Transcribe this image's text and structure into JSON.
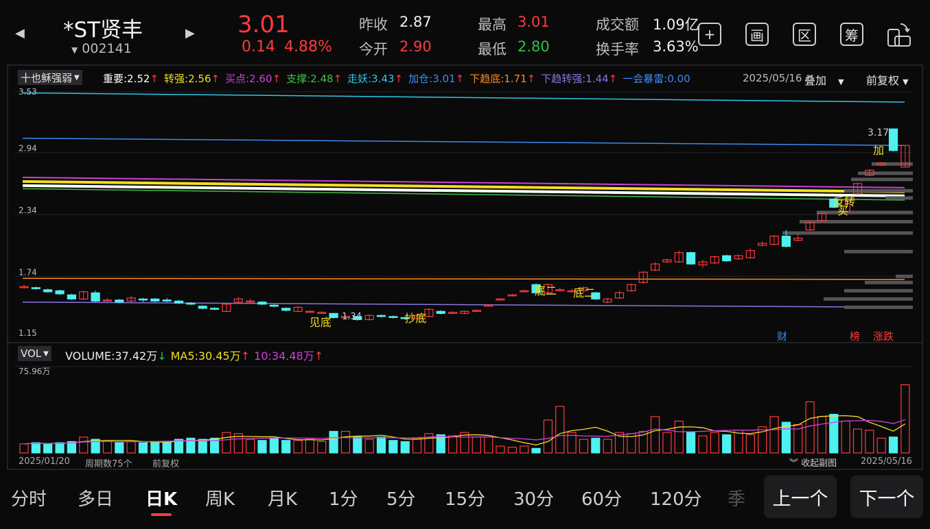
{
  "stock": {
    "name": "*ST贤丰",
    "code": "002141",
    "price": "3.01",
    "change": "0.14",
    "change_pct": "4.88%",
    "prev_close_label": "昨收",
    "prev_close": "2.87",
    "open_label": "今开",
    "open": "2.90",
    "high_label": "最高",
    "high": "3.01",
    "low_label": "最低",
    "low": "2.80",
    "amount_label": "成交额",
    "amount": "1.09亿",
    "turnover_label": "换手率",
    "turnover": "3.63%"
  },
  "toolbar": {
    "add": "+",
    "draw": "画",
    "zone": "区",
    "chip": "筹"
  },
  "indicator": {
    "selector": "十也稣强弱",
    "items": [
      {
        "label": "重要:2.52",
        "arrow": "↑",
        "color": "#ffffff"
      },
      {
        "label": "转强:2.56",
        "arrow": "↑",
        "color": "#f0e020"
      },
      {
        "label": "买点:2.60",
        "arrow": "↑",
        "color": "#d040d8"
      },
      {
        "label": "支撑:2.48",
        "arrow": "↑",
        "color": "#40c040"
      },
      {
        "label": "走妖:3.43",
        "arrow": "↑",
        "color": "#30c8e8"
      },
      {
        "label": "加仓:3.01",
        "arrow": "↑",
        "color": "#3c8cf0"
      },
      {
        "label": "下趋底:1.71",
        "arrow": "↑",
        "color": "#ff8c1a"
      },
      {
        "label": "下趋转强:1.44",
        "arrow": "↑",
        "color": "#8878e0"
      },
      {
        "label": "一会暴雷:0.00",
        "arrow": "",
        "color": "#3c8cf0"
      }
    ],
    "date": "2025/05/16",
    "overlay": "叠加",
    "adjust": "前复权"
  },
  "price_axis": [
    "3.53",
    "2.94",
    "2.34",
    "1.74",
    "1.15"
  ],
  "annotations": {
    "jiandi": "见底",
    "low_val": "1.34",
    "chaodi": "抄底",
    "dier1": "底二",
    "dier2": "底二",
    "fanzhuan": "反转",
    "mai": "买",
    "jia": "加",
    "high_val": "3.17",
    "cai": "财",
    "bang": "榜",
    "zhangdie": "涨跌"
  },
  "volume": {
    "selector": "VOL",
    "label": "VOLUME:37.42万",
    "label_arrow": "↓",
    "ma5": "MA5:30.45万",
    "ma5_arrow": "↑",
    "ma10": "10:34.48万",
    "ma10_arrow": "↑",
    "axis_max": "75.96万"
  },
  "footer": {
    "start_date": "2025/01/20",
    "period_count": "周期数75个",
    "adjust": "前复权",
    "collapse": "收起副图",
    "end_date": "2025/05/16"
  },
  "tabs": [
    "分时",
    "多日",
    "日K",
    "周K",
    "月K",
    "1分",
    "5分",
    "15分",
    "30分",
    "60分",
    "120分",
    "季"
  ],
  "active_tab": 2,
  "nav": {
    "prev": "上一个",
    "next": "下一个"
  },
  "colors": {
    "up": "#ff3b3b",
    "down": "#4ef0f0",
    "bg": "#0a0a0b"
  },
  "chart_data": {
    "type": "candlestick",
    "price_range": [
      1.15,
      3.53
    ],
    "volume_max_wan": 75.96,
    "candles": [
      [
        1.63,
        1.64,
        1.66,
        1.62
      ],
      [
        1.63,
        1.62,
        1.64,
        1.61
      ],
      [
        1.61,
        1.59,
        1.62,
        1.58
      ],
      [
        1.6,
        1.57,
        1.61,
        1.56
      ],
      [
        1.56,
        1.52,
        1.57,
        1.51
      ],
      [
        1.52,
        1.59,
        1.6,
        1.51
      ],
      [
        1.58,
        1.5,
        1.6,
        1.49
      ],
      [
        1.51,
        1.51,
        1.53,
        1.5
      ],
      [
        1.51,
        1.49,
        1.52,
        1.48
      ],
      [
        1.5,
        1.53,
        1.55,
        1.49
      ],
      [
        1.52,
        1.51,
        1.53,
        1.49
      ],
      [
        1.52,
        1.5,
        1.53,
        1.49
      ],
      [
        1.51,
        1.5,
        1.53,
        1.49
      ],
      [
        1.5,
        1.48,
        1.51,
        1.47
      ],
      [
        1.48,
        1.47,
        1.49,
        1.46
      ],
      [
        1.45,
        1.43,
        1.46,
        1.42
      ],
      [
        1.43,
        1.42,
        1.44,
        1.41
      ],
      [
        1.4,
        1.47,
        1.48,
        1.39
      ],
      [
        1.49,
        1.52,
        1.54,
        1.48
      ],
      [
        1.5,
        1.5,
        1.52,
        1.48
      ],
      [
        1.49,
        1.47,
        1.5,
        1.46
      ],
      [
        1.46,
        1.45,
        1.47,
        1.44
      ],
      [
        1.43,
        1.41,
        1.44,
        1.4
      ],
      [
        1.4,
        1.44,
        1.45,
        1.39
      ],
      [
        1.4,
        1.4,
        1.41,
        1.39
      ],
      [
        1.39,
        1.39,
        1.4,
        1.38
      ],
      [
        1.38,
        1.34,
        1.38,
        1.33
      ],
      [
        1.35,
        1.35,
        1.36,
        1.34
      ],
      [
        1.35,
        1.32,
        1.36,
        1.31
      ],
      [
        1.32,
        1.36,
        1.37,
        1.31
      ],
      [
        1.36,
        1.35,
        1.37,
        1.34
      ],
      [
        1.35,
        1.34,
        1.36,
        1.33
      ],
      [
        1.34,
        1.33,
        1.35,
        1.32
      ],
      [
        1.33,
        1.36,
        1.37,
        1.32
      ],
      [
        1.35,
        1.42,
        1.43,
        1.34
      ],
      [
        1.4,
        1.38,
        1.41,
        1.37
      ],
      [
        1.39,
        1.39,
        1.4,
        1.38
      ],
      [
        1.38,
        1.4,
        1.41,
        1.37
      ],
      [
        1.4,
        1.41,
        1.42,
        1.39
      ],
      [
        1.46,
        1.46,
        1.47,
        1.45
      ],
      [
        1.52,
        1.52,
        1.53,
        1.51
      ],
      [
        1.56,
        1.56,
        1.57,
        1.55
      ],
      [
        1.6,
        1.6,
        1.61,
        1.59
      ],
      [
        1.66,
        1.58,
        1.67,
        1.57
      ],
      [
        1.58,
        1.66,
        1.67,
        1.57
      ],
      [
        1.61,
        1.61,
        1.63,
        1.59
      ],
      [
        1.59,
        1.6,
        1.62,
        1.58
      ],
      [
        1.6,
        1.63,
        1.64,
        1.58
      ],
      [
        1.58,
        1.52,
        1.59,
        1.51
      ],
      [
        1.49,
        1.52,
        1.53,
        1.48
      ],
      [
        1.53,
        1.58,
        1.6,
        1.52
      ],
      [
        1.6,
        1.66,
        1.67,
        1.59
      ],
      [
        1.68,
        1.78,
        1.79,
        1.67
      ],
      [
        1.8,
        1.86,
        1.88,
        1.79
      ],
      [
        1.88,
        1.9,
        1.91,
        1.87
      ],
      [
        1.88,
        1.97,
        1.99,
        1.87
      ],
      [
        1.97,
        1.86,
        1.98,
        1.85
      ],
      [
        1.85,
        1.88,
        1.9,
        1.82
      ],
      [
        1.87,
        1.93,
        1.94,
        1.86
      ],
      [
        1.94,
        1.89,
        1.95,
        1.88
      ],
      [
        1.91,
        1.94,
        1.95,
        1.9
      ],
      [
        1.92,
        1.99,
        2.01,
        1.91
      ],
      [
        2.04,
        2.06,
        2.08,
        2.03
      ],
      [
        2.05,
        2.13,
        2.14,
        2.04
      ],
      [
        2.13,
        2.03,
        2.19,
        2.02
      ],
      [
        2.09,
        2.11,
        2.15,
        2.08
      ],
      [
        2.19,
        2.26,
        2.27,
        2.18
      ],
      [
        2.28,
        2.35,
        2.36,
        2.27
      ],
      [
        2.49,
        2.41,
        2.5,
        2.4
      ],
      [
        2.37,
        2.48,
        2.49,
        2.36
      ],
      [
        2.54,
        2.64,
        2.65,
        2.53
      ],
      [
        2.72,
        2.77,
        2.78,
        2.71
      ],
      [
        2.82,
        2.84,
        2.85,
        2.81
      ],
      [
        3.17,
        2.96,
        3.17,
        2.95
      ],
      [
        2.8,
        3.01,
        3.01,
        2.8
      ]
    ],
    "volumes": [
      8,
      9,
      8,
      9,
      10,
      14,
      12,
      10,
      9,
      10,
      9,
      10,
      10,
      12,
      13,
      12,
      13,
      18,
      17,
      12,
      11,
      13,
      11,
      11,
      12,
      10,
      19,
      19,
      14,
      12,
      14,
      11,
      10,
      13,
      17,
      16,
      15,
      18,
      14,
      14,
      6,
      5,
      6,
      4,
      29,
      41,
      18,
      12,
      13,
      12,
      18,
      17,
      19,
      32,
      18,
      28,
      18,
      15,
      18,
      16,
      20,
      16,
      23,
      32,
      27,
      25,
      45,
      32,
      34,
      28,
      21,
      20,
      13,
      14,
      60
    ]
  }
}
